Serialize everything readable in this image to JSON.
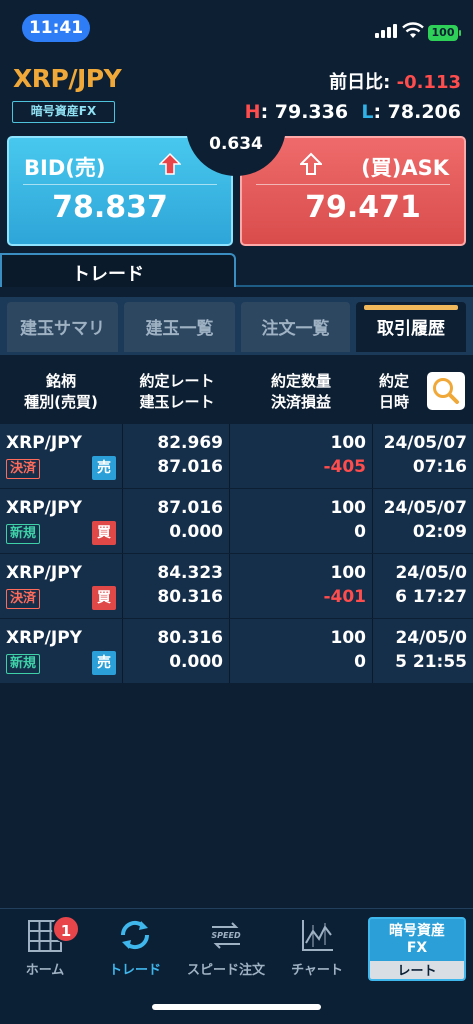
{
  "status_bar": {
    "time": "11:41",
    "battery": "100"
  },
  "header": {
    "symbol": "XRP/JPY",
    "badge": "暗号資産FX",
    "prev_day_label": "前日比:",
    "prev_day_value": "-0.113",
    "high_label": "H",
    "high_value": ": 79.336",
    "low_label": "L",
    "low_value": ": 78.206"
  },
  "quote": {
    "bid_label": "BID(売)",
    "bid_price": "78.837",
    "ask_label": "(買)ASK",
    "ask_price": "79.471",
    "spread": "0.634"
  },
  "trade_tab": "トレード",
  "subtabs": [
    "建玉サマリ",
    "建玉一覧",
    "注文一覧",
    "取引履歴"
  ],
  "table_header": {
    "col1_a": "銘柄",
    "col1_b": "種別(売買)",
    "col2_a": "約定レート",
    "col2_b": "建玉レート",
    "col3_a": "約定数量",
    "col3_b": "決済損益",
    "col4_a": "約定",
    "col4_b": "日時"
  },
  "rows": [
    {
      "symbol": "XRP/JPY",
      "type": "決済",
      "side": "売",
      "exec_rate": "82.969",
      "pos_rate": "87.016",
      "qty": "100",
      "pnl": "-405",
      "date_a": "24/05/07",
      "date_b": "07:16"
    },
    {
      "symbol": "XRP/JPY",
      "type": "新規",
      "side": "買",
      "exec_rate": "87.016",
      "pos_rate": "0.000",
      "qty": "100",
      "pnl": "0",
      "date_a": "24/05/07",
      "date_b": "02:09"
    },
    {
      "symbol": "XRP/JPY",
      "type": "決済",
      "side": "買",
      "exec_rate": "84.323",
      "pos_rate": "80.316",
      "qty": "100",
      "pnl": "-401",
      "date_a": "24/05/0",
      "date_b": "6 17:27"
    },
    {
      "symbol": "XRP/JPY",
      "type": "新規",
      "side": "売",
      "exec_rate": "80.316",
      "pos_rate": "0.000",
      "qty": "100",
      "pnl": "0",
      "date_a": "24/05/0",
      "date_b": "5 21:55"
    }
  ],
  "nav": {
    "home": "ホーム",
    "home_badge": "1",
    "trade": "トレード",
    "speed_order": "スピード注文",
    "chart": "チャート",
    "fx_top": "暗号資産\nFX",
    "fx_bottom": "レート"
  },
  "colors": {
    "accent": "#3fb6ec",
    "bid": "#2ea5d8",
    "ask": "#d94c4c",
    "negative": "#ff4d4d",
    "symbol": "#f0a838"
  }
}
